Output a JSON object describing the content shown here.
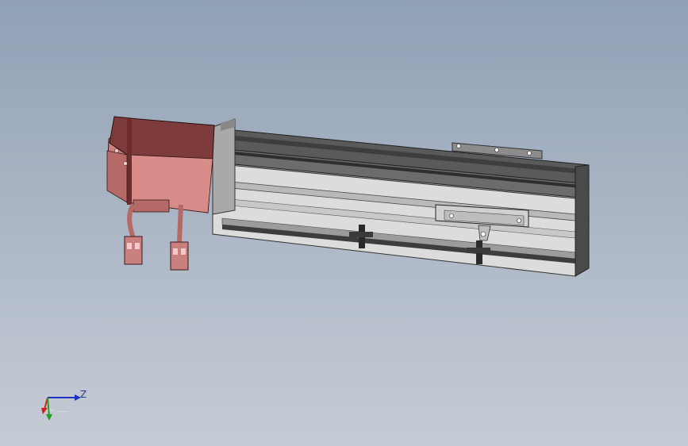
{
  "viewport": {
    "background_top": "#8fa1b6",
    "background_bottom": "#c6ccd6"
  },
  "model": {
    "parts": [
      "servo-motor",
      "motor-cable-left",
      "motor-cable-right",
      "connector-left",
      "connector-right",
      "linear-actuator-body",
      "actuator-top-rail",
      "carriage-slider",
      "limit-sensor-1",
      "limit-sensor-2",
      "mounting-bracket"
    ],
    "colors": {
      "motor": "#c87a78",
      "motor_dark": "#7a3a3a",
      "actuator_light": "#d8d8d8",
      "actuator_dark": "#6f6f6f",
      "rail_dark": "#4c4c4c"
    }
  },
  "triad": {
    "axis_label": "Z",
    "x_color": "#d22020",
    "y_color": "#20a020",
    "z_color": "#2030c0"
  }
}
